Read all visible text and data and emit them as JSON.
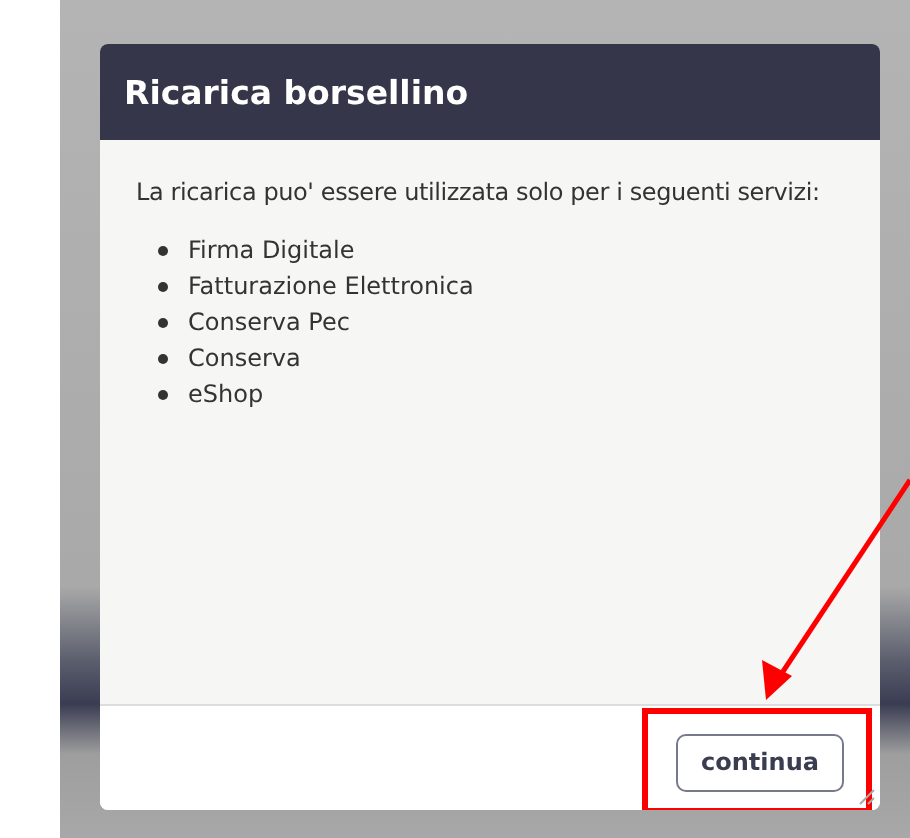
{
  "dialog": {
    "title": "Ricarica borsellino",
    "intro": "La ricarica puo' essere utilizzata solo per i seguenti servizi:",
    "services": [
      "Firma Digitale",
      "Fatturazione Elettronica",
      "Conserva Pec",
      "Conserva",
      "eShop"
    ],
    "buttons": [
      {
        "label": "continua",
        "highlighted": true
      }
    ]
  }
}
